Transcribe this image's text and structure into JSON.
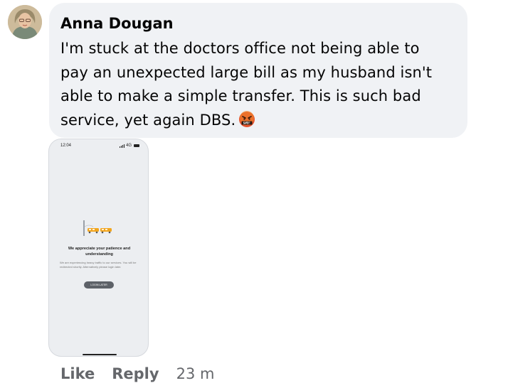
{
  "comment": {
    "author": "Anna Dougan",
    "text": "I'm stuck at the doctors office not being able to pay an unexpected large bill as my husband isn't able to make a simple transfer. This is such bad service, yet again DBS.",
    "emoji": "face-with-symbols-on-mouth-emoji"
  },
  "attachment": {
    "status_time": "12:04",
    "status_network": "4G",
    "title": "We appreciate your patience and understanding",
    "body": "We are experiencing heavy traffic to our services. You will be redirected shortly. Alternatively please login later.",
    "button": "LOGIN LATER"
  },
  "actions": {
    "like": "Like",
    "reply": "Reply",
    "time_ago": "23 m"
  },
  "colors": {
    "bubble_bg": "#f0f2f5",
    "text": "#050505",
    "meta": "#65676b"
  }
}
